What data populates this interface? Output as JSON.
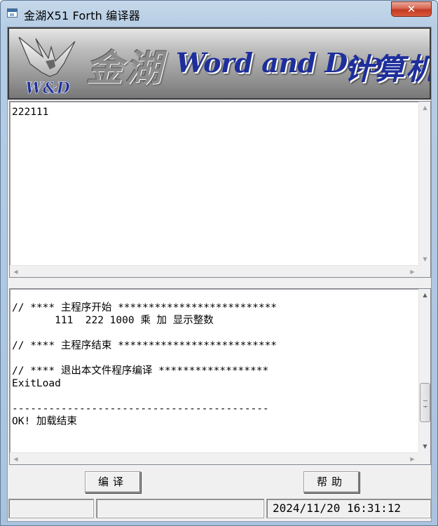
{
  "window": {
    "title": "金湖X51 Forth 编译器",
    "close_label": "✕"
  },
  "banner": {
    "logo_text": "W&D",
    "chinese_text": "金湖",
    "english_text": "Word and Door",
    "suffix_text": "计算机"
  },
  "output": {
    "text": "222111"
  },
  "code": {
    "lines": [
      "// **** 主程序开始 **************************",
      "       111  222 1000 乘 加 显示整数",
      "",
      "// **** 主程序结束 **************************",
      "",
      "// **** 退出本文件程序编译 ******************",
      "ExitLoad",
      "",
      "------------------------------------------",
      "OK! 加载结束"
    ]
  },
  "buttons": {
    "compile": "编译",
    "help": "帮助"
  },
  "status": {
    "panel1": "",
    "panel2": "",
    "datetime": "2024/11/20 16:31:12"
  },
  "icons": {
    "app": "window-app-icon",
    "close": "close-icon",
    "scroll_up": "arrow-up-icon",
    "scroll_down": "arrow-down-icon",
    "scroll_left": "arrow-left-icon",
    "scroll_right": "arrow-right-icon"
  }
}
